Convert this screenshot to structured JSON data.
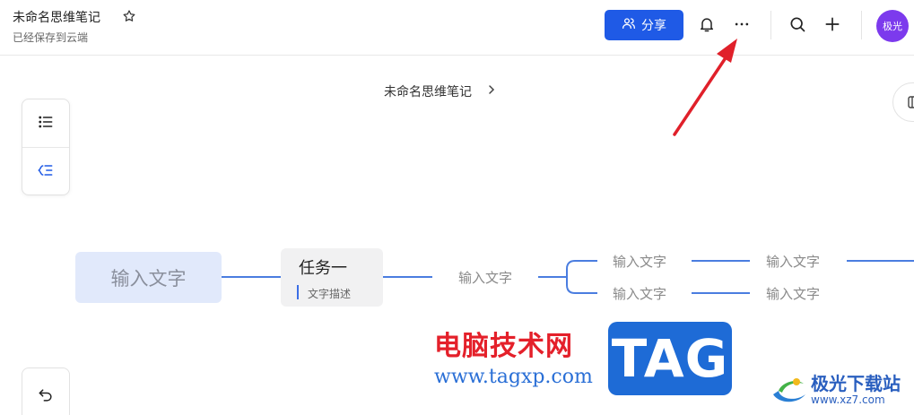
{
  "header": {
    "doc_title": "未命名思维笔记",
    "save_status": "已经保存到云端",
    "share_label": "分享",
    "avatar_text": "极光"
  },
  "breadcrumb": {
    "label": "未命名思维笔记"
  },
  "mindmap": {
    "root": "输入文字",
    "task": {
      "title": "任务一",
      "description": "文字描述"
    },
    "branch": "输入文字",
    "children": [
      "输入文字",
      "输入文字"
    ],
    "grandchildren": [
      "输入文字",
      "输入文字"
    ]
  },
  "icons": {
    "star": "star-icon",
    "share": "users-icon",
    "bell": "bell-icon",
    "more": "more-icon",
    "search": "search-icon",
    "plus": "plus-icon",
    "outline": "list-icon",
    "structure": "structure-icon",
    "undo": "undo-icon"
  },
  "colors": {
    "accent": "#1f5ae6",
    "avatar": "#7c3aed",
    "root_fill": "#e1e9fb",
    "connector": "#4a7de0",
    "annotation_arrow": "#e0202a"
  },
  "watermarks": {
    "site_cn": "电脑技术网",
    "site_url": "www.tagxp.com",
    "tag_logo": "TAG",
    "download_site_name": "极光下载站",
    "download_site_url": "www.xz7.com"
  }
}
